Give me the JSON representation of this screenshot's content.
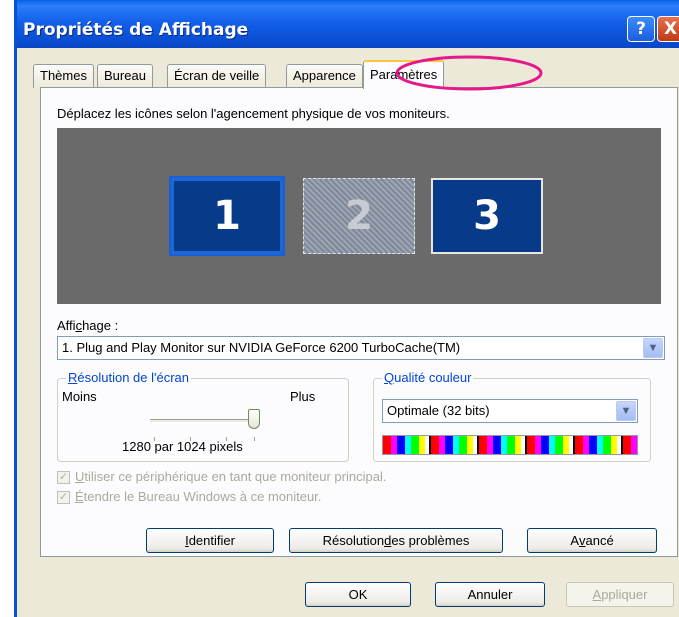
{
  "window": {
    "title": "Propriétés de Affichage",
    "help_glyph": "?",
    "close_glyph": "X"
  },
  "tabs": [
    {
      "label": "Thèmes"
    },
    {
      "label": "Bureau"
    },
    {
      "label": "Écran de veille"
    },
    {
      "label": "Apparence"
    },
    {
      "label": "Paramètres",
      "selected": true
    }
  ],
  "settings": {
    "instruction": "Déplacez les icônes selon l'agencement physique de vos moniteurs.",
    "monitors": [
      {
        "number": "1",
        "state": "selected"
      },
      {
        "number": "2",
        "state": "inactive"
      },
      {
        "number": "3",
        "state": "active"
      }
    ],
    "display_label_pre": "Affi",
    "display_label_key": "c",
    "display_label_post": "hage :",
    "display_value": "1. Plug and Play Monitor sur NVIDIA GeForce 6200 TurboCache(TM)",
    "resolution": {
      "title_key": "R",
      "title_rest": "ésolution de l'écran",
      "less": "Moins",
      "more": "Plus",
      "value_text": "1280 par 1024 pixels",
      "slider_level": 1.0
    },
    "color_quality": {
      "title_key": "Q",
      "title_rest": "ualité couleur",
      "value": "Optimale (32 bits)"
    },
    "checkbox_primary": {
      "key": "U",
      "rest": "tiliser ce périphérique en tant que moniteur principal.",
      "checked": true,
      "enabled": false
    },
    "checkbox_extend": {
      "key": "É",
      "rest": "tendre le Bureau Windows à ce moniteur.",
      "checked": true,
      "enabled": false
    },
    "check_glyph": "✓",
    "dropdown_glyph": "▼"
  },
  "buttons": {
    "identify_key": "I",
    "identify_rest": "dentifier",
    "troubleshoot_pre": "Résolution ",
    "troubleshoot_key": "d",
    "troubleshoot_post": "es problèmes",
    "advanced_pre": "A",
    "advanced_key": "v",
    "advanced_post": "ancé",
    "ok": "OK",
    "cancel": "Annuler",
    "apply_key": "A",
    "apply_rest": "ppliquer"
  },
  "colors": {
    "title_bar": "#0a5fe8",
    "highlight_ring": "#e6198a",
    "monitor_fill": "#083a8a",
    "group_title": "#0046d5"
  }
}
